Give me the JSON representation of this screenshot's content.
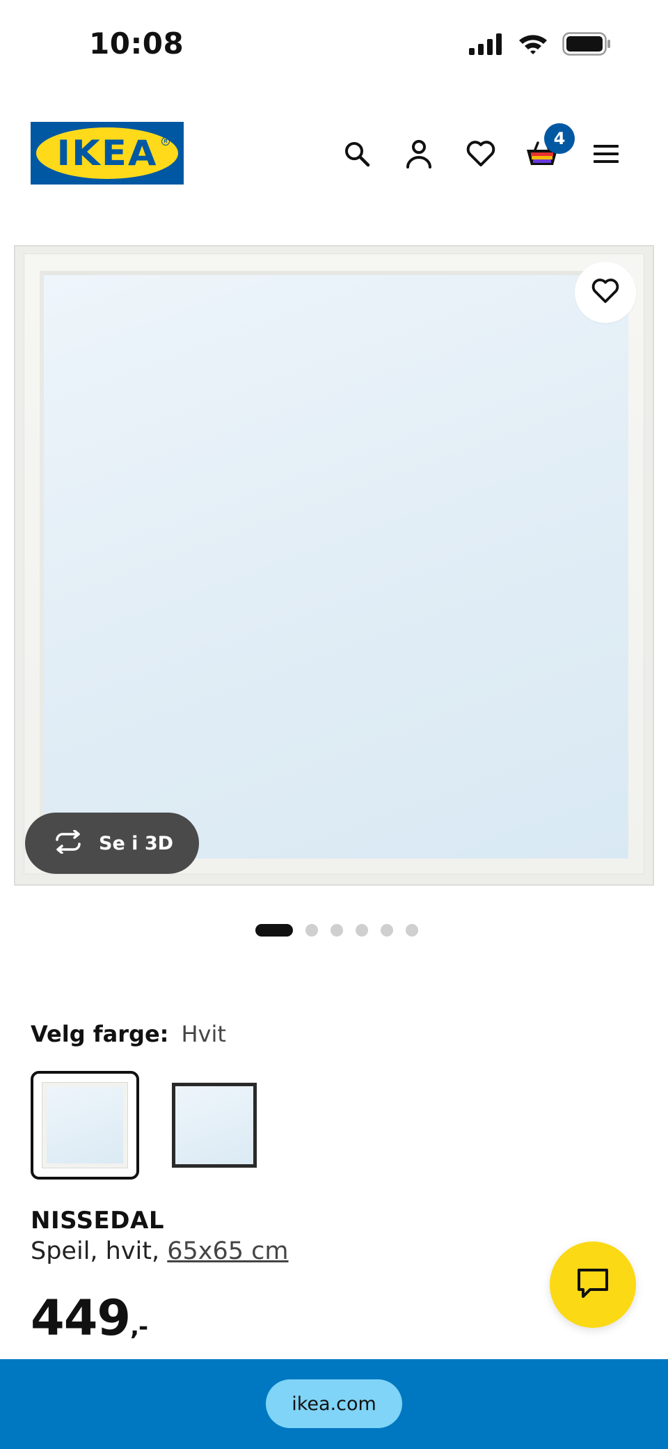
{
  "status_bar": {
    "time": "10:08"
  },
  "header": {
    "logo_text": "IKEA",
    "cart_count": "4",
    "icons": [
      "search-icon",
      "account-icon",
      "heart-icon",
      "cart-icon",
      "menu-icon"
    ]
  },
  "gallery": {
    "view_3d_label": "Se i 3D",
    "image_count": 6,
    "active_index": 0
  },
  "color_selector": {
    "label": "Velg farge:",
    "value": "Hvit",
    "options": [
      "white",
      "black"
    ],
    "selected": "white"
  },
  "product": {
    "name": "NISSEDAL",
    "description_prefix": "Speil, hvit, ",
    "size": "65x65 cm",
    "price": "449",
    "price_suffix": ",-"
  },
  "browser": {
    "url": "ikea.com"
  },
  "colors": {
    "brand_blue": "#0058a3",
    "brand_yellow": "#ffda1a",
    "chat_yellow": "#fbd914",
    "bottom_bar": "#0077c1",
    "url_pill": "#7fd4f7"
  }
}
